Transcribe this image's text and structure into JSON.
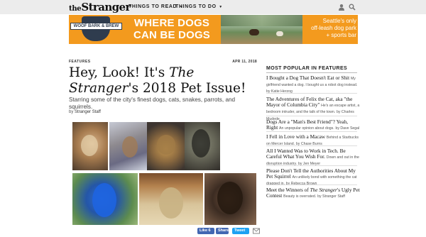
{
  "header": {
    "logo_text_the": "the",
    "logo_text_main": "Stranger",
    "nav": [
      {
        "label": "THINGS TO READ"
      },
      {
        "label": "THINGS TO DO"
      }
    ],
    "icons": [
      "user-icon",
      "search-icon"
    ]
  },
  "ad": {
    "brand_lines": [
      "WOOF BARK & BREW"
    ],
    "headline": "WHERE DOGS CAN BE DOGS",
    "side_line1": "Seattle's only",
    "side_line2": "off-leash dog park",
    "side_line3": "+ sports bar",
    "accent": "#f39a1e"
  },
  "article": {
    "kicker": "FEATURES",
    "date": "APR 11, 2018",
    "title_part1": "Hey, Look! It's ",
    "title_italic": "The Stranger",
    "title_part2": "'s 2018 Pet Issue!",
    "dek": "Starring some of the city's finest dogs, cats, snakes, parrots, and squirrels.",
    "by_prefix": "by ",
    "author": "Stranger Staff",
    "photos": [
      "dog-photo",
      "squirrel-photo",
      "cat-photo",
      "dark-cat-photo",
      "parrot-photo",
      "sphinx-cat-photo",
      "lab-dog-photo"
    ]
  },
  "share": {
    "like": "Like 6",
    "share": "Share",
    "tweet": "Tweet"
  },
  "sidebar": {
    "title": "MOST POPULAR IN FEATURES",
    "items": [
      {
        "headline": "I Bought a Dog That Doesn't Eat or Shit",
        "sub": "My girlfriend wanted a dog. I bought us a robot dog instead.",
        "byline": "by Katie Herzog"
      },
      {
        "headline": "The Adventures of Felix the Cat, aka \"the Mayor of Columbia City\"",
        "sub": "He's an escape artist, a bedroom intruder, and the talk of the town.",
        "byline": "by Charles Mudede"
      },
      {
        "headline": "Dogs Are a \"Man's Best Friend\"? Yeah, Right",
        "sub": "An unpopular opinion about dogs.",
        "byline": "by Dave Segal"
      },
      {
        "headline": "I Fell in Love with a Macaw",
        "sub": "Behind a Starbucks on Mercer Island.",
        "byline": "by Chase Burns"
      },
      {
        "headline": "All I Wanted Was to Work in Tech. Be Careful What You Wish For.",
        "sub": "Down and out in the disruption industry.",
        "byline": "by Jen Meyer"
      },
      {
        "headline": "Please Don't Tell the Authorities About My Pet Squirrel",
        "sub": "An unlikely bond with something the cat dragged in.",
        "byline": "by Rebecca Brown"
      },
      {
        "headline_pre": "Meet the Winners of ",
        "headline_italic": "The Stranger",
        "headline_post": "'s Ugly Pet Contest",
        "sub": "Beauty is overrated.",
        "byline": "by Stranger Staff"
      }
    ]
  }
}
